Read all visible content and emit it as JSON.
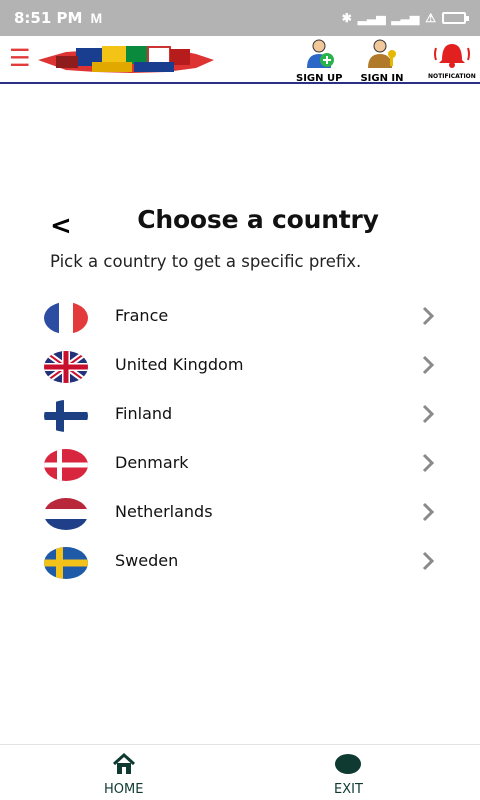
{
  "status": {
    "time": "8:51 PM",
    "mail_icon": "gmail-icon",
    "battery_icon": "battery-icon"
  },
  "topbar": {
    "menu_icon": "hamburger-icon",
    "signup_label": "SIGN UP",
    "signin_label": "SIGN IN",
    "notification_label": "NOTIFICATION"
  },
  "page": {
    "title": "Choose a country",
    "subtitle": "Pick a country to get a specific prefix."
  },
  "countries": [
    {
      "name": "France"
    },
    {
      "name": "United Kingdom"
    },
    {
      "name": "Finland"
    },
    {
      "name": "Denmark"
    },
    {
      "name": "Netherlands"
    },
    {
      "name": "Sweden"
    }
  ],
  "bottomnav": {
    "home_label": "HOME",
    "exit_label": "EXIT"
  },
  "colors": {
    "accent": "#2b2f86",
    "menu": "#e23b3b",
    "nav": "#0e3a32"
  }
}
